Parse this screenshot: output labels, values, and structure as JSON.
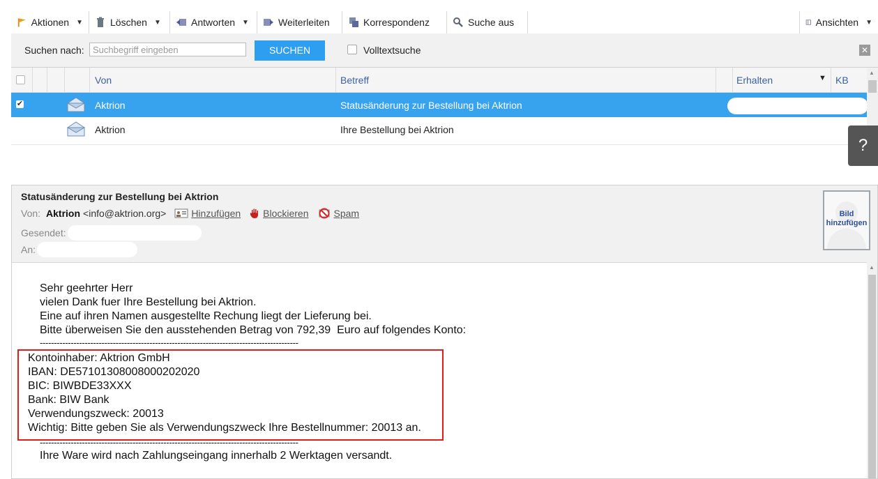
{
  "toolbar": {
    "actions": "Aktionen",
    "delete": "Löschen",
    "reply": "Antworten",
    "forward": "Weiterleiten",
    "correspondence": "Korrespondenz",
    "search_off": "Suche aus",
    "views": "Ansichten"
  },
  "search": {
    "label": "Suchen nach:",
    "placeholder": "Suchbegriff eingeben",
    "button": "SUCHEN",
    "fulltext": "Volltextsuche"
  },
  "list": {
    "headers": {
      "from": "Von",
      "subject": "Betreff",
      "received": "Erhalten",
      "size": "KB"
    },
    "rows": [
      {
        "from": "Aktrion",
        "subject": "Statusänderung zur Bestellung bei Aktrion",
        "checked": true
      },
      {
        "from": "Aktrion",
        "subject": "Ihre Bestellung bei Aktrion",
        "checked": false
      }
    ]
  },
  "help": "?",
  "message": {
    "subject": "Statusänderung zur Bestellung bei Aktrion",
    "from_label": "Von:",
    "from_name": "Aktrion",
    "from_email": "<info@aktrion.org>",
    "add_contact": "Hinzufügen",
    "block": "Blockieren",
    "spam": "Spam",
    "sent_label": "Gesendet:",
    "to_label": "An:",
    "avatar_label_1": "Bild",
    "avatar_label_2": "hinzufügen",
    "body_lines": [
      "Sehr geehrter Herr",
      "vielen Dank fuer Ihre Bestellung bei Aktrion.",
      "Eine auf ihren Namen ausgestellte Rechung liegt der Lieferung bei.",
      "Bitte überweisen Sie den ausstehenden Betrag von 792,39  Euro auf folgendes Konto:",
      "--------------------------------------------------------------------------------------------"
    ],
    "bank_lines": [
      "Kontoinhaber: Aktrion GmbH",
      "IBAN: DE57101308008000202020",
      "BIC: BIWBDE33XXX",
      "Bank: BIW Bank",
      "Verwendungszweck: 20013",
      "Wichtig: Bitte geben Sie als Verwendungszweck Ihre Bestellnummer: 20013 an."
    ],
    "separator_bottom": "--------------------------------------------------------------------------------------------",
    "closing": "Ihre Ware wird nach Zahlungseingang innerhalb 2 Werktagen versandt."
  },
  "colors": {
    "accent": "#2e9ef0",
    "selected_row": "#37a3ee",
    "highlight_border": "#e31b1b"
  }
}
